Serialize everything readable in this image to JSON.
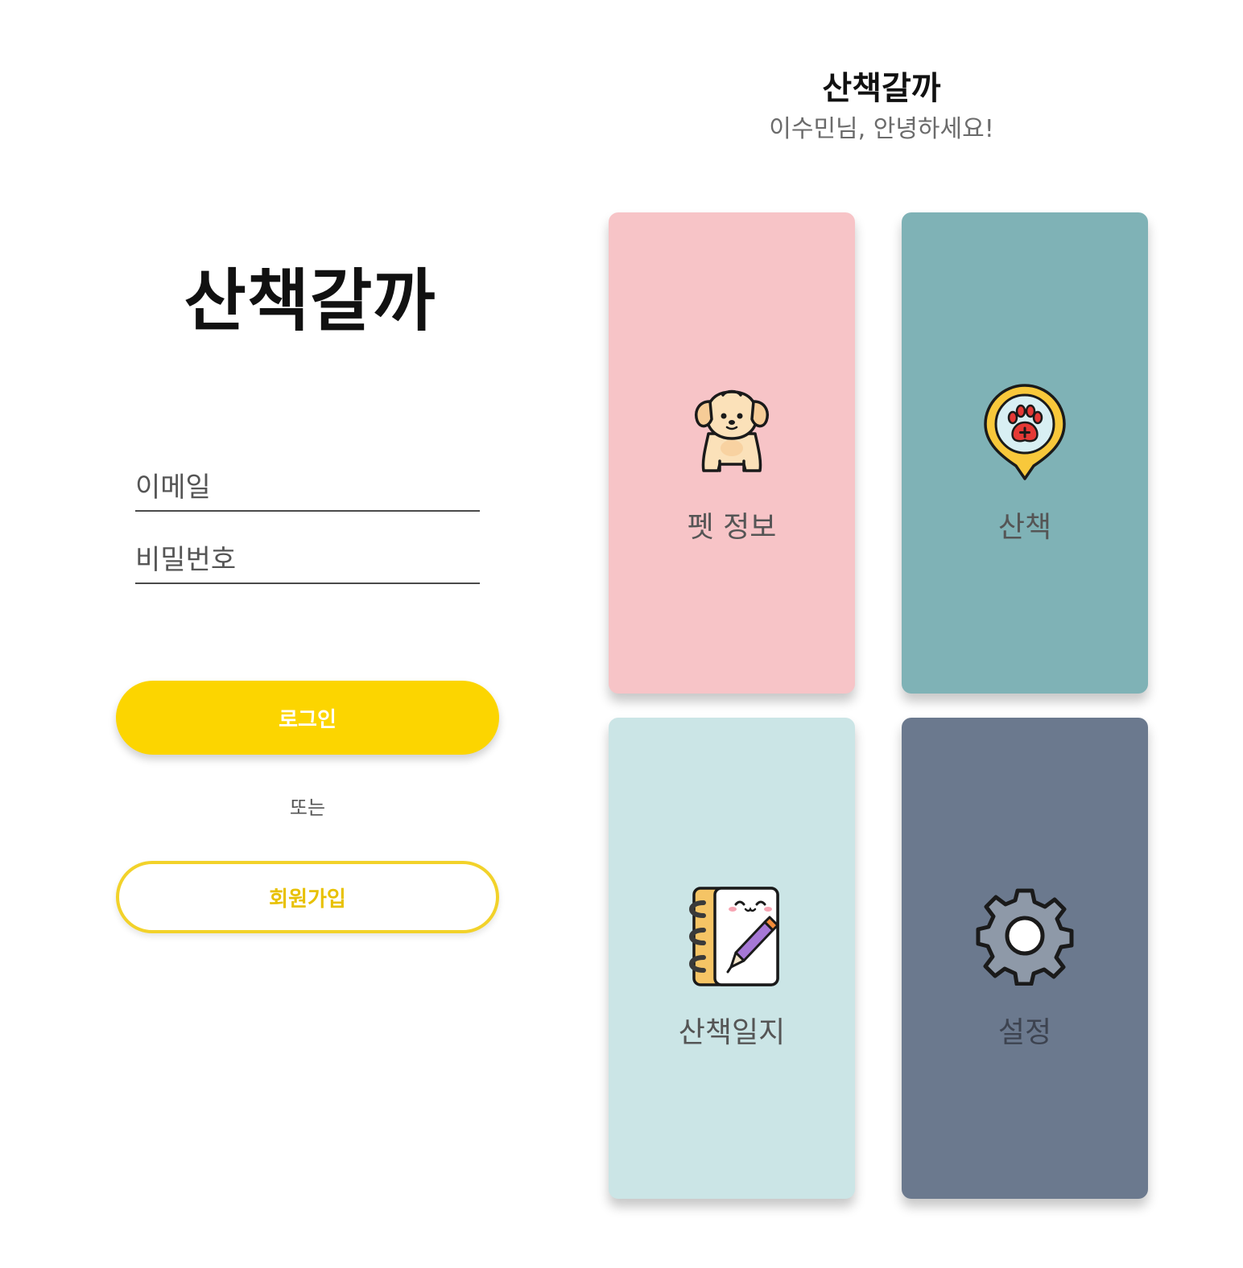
{
  "login": {
    "logo": "산책갈까",
    "email_placeholder": "이메일",
    "password_placeholder": "비밀번호",
    "login_button": "로그인",
    "or_text": "또는",
    "signup_button": "회원가입"
  },
  "home": {
    "title": "산책갈까",
    "greeting": "이수민님, 안녕하세요!",
    "cards": [
      {
        "label": "펫 정보",
        "icon": "dog-icon",
        "color": "#f7c4c7"
      },
      {
        "label": "산책",
        "icon": "paw-location-pin-icon",
        "color": "#7fb2b6"
      },
      {
        "label": "산책일지",
        "icon": "notebook-pen-icon",
        "color": "#cbe5e6"
      },
      {
        "label": "설정",
        "icon": "gear-icon",
        "color": "#6b798e"
      }
    ]
  },
  "colors": {
    "accent": "#fcd500",
    "signup_border": "#f2d22a"
  }
}
